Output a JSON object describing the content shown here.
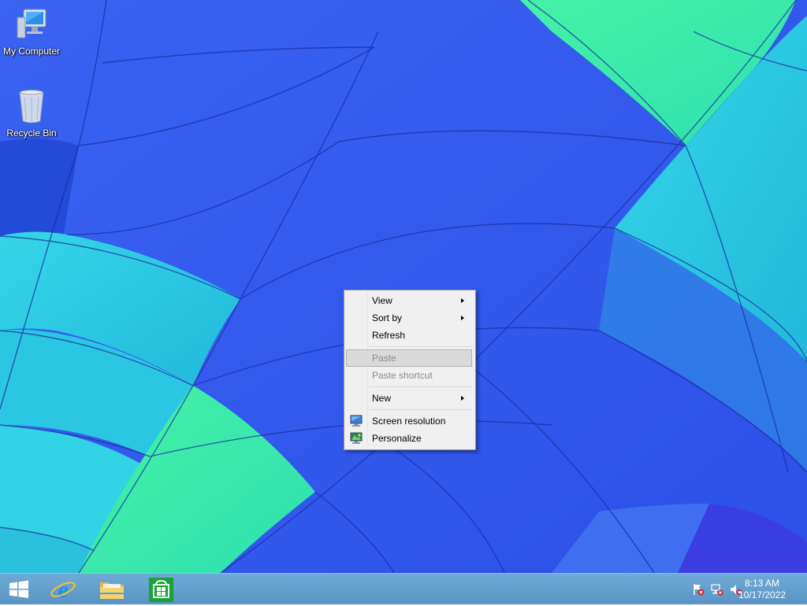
{
  "desktop": {
    "icons": [
      {
        "label": "My Computer",
        "icon": "computer-icon"
      },
      {
        "label": "Recycle Bin",
        "icon": "recycle-bin-icon"
      }
    ]
  },
  "context_menu": {
    "items": [
      {
        "label": "View",
        "submenu": true,
        "enabled": true
      },
      {
        "label": "Sort by",
        "submenu": true,
        "enabled": true
      },
      {
        "label": "Refresh",
        "submenu": false,
        "enabled": true
      },
      {
        "label": "Paste",
        "submenu": false,
        "enabled": false,
        "highlighted": true
      },
      {
        "label": "Paste shortcut",
        "submenu": false,
        "enabled": false
      },
      {
        "label": "New",
        "submenu": true,
        "enabled": true
      },
      {
        "label": "Screen resolution",
        "submenu": false,
        "enabled": true,
        "icon": "monitor-icon"
      },
      {
        "label": "Personalize",
        "submenu": false,
        "enabled": true,
        "icon": "personalize-icon"
      }
    ]
  },
  "taskbar": {
    "buttons": [
      {
        "name": "start-button",
        "icon": "windows-logo-icon"
      },
      {
        "name": "internet-explorer-button",
        "icon": "internet-explorer-icon"
      },
      {
        "name": "file-explorer-button",
        "icon": "folder-icon"
      },
      {
        "name": "store-button",
        "icon": "store-icon"
      }
    ],
    "tray": {
      "icons": [
        "action-center-flag-icon",
        "network-icon",
        "volume-muted-icon"
      ],
      "time": "8:13 AM",
      "date": "10/17/2022"
    }
  },
  "colors": {
    "wallpaper_blue": "#2f5ff0",
    "wallpaper_cyan": "#2fd0e0",
    "wallpaper_green": "#3ef0a8",
    "menu_bg": "#f0f0f0",
    "taskbar": "#5a95c6"
  }
}
